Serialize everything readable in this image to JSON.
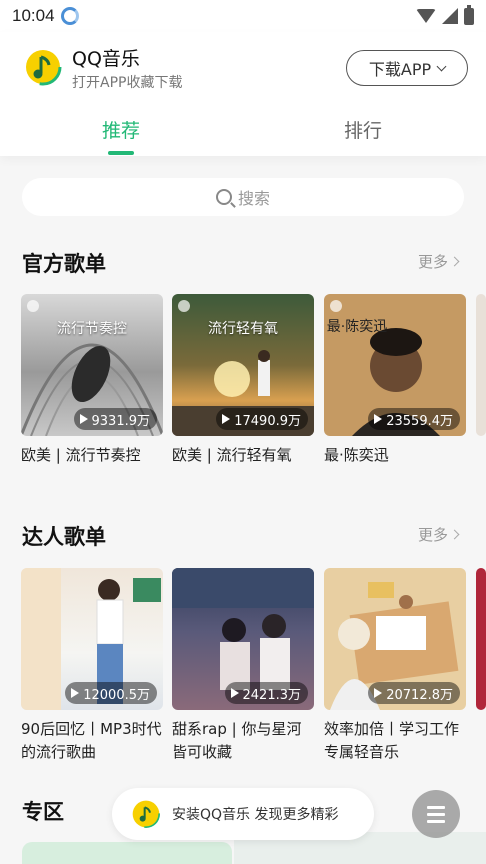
{
  "status_bar": {
    "time": "10:04"
  },
  "header": {
    "app_name": "QQ音乐",
    "subtitle": "打开APP收藏下载",
    "download_label": "下载APP"
  },
  "tabs": [
    {
      "label": "推荐",
      "active": true
    },
    {
      "label": "排行",
      "active": false
    }
  ],
  "search": {
    "placeholder": "搜索"
  },
  "sections": {
    "official": {
      "title": "官方歌单",
      "more": "更多",
      "items": [
        {
          "cover_text": "流行节奏控",
          "plays": "9331.9万",
          "title": "欧美 | 流行节奏控"
        },
        {
          "cover_text": "流行轻有氧",
          "plays": "17490.9万",
          "title": "欧美 | 流行轻有氧"
        },
        {
          "cover_text": "最·陈奕迅",
          "plays": "23559.4万",
          "title": "最·陈奕迅"
        }
      ]
    },
    "expert": {
      "title": "达人歌单",
      "more": "更多",
      "items": [
        {
          "plays": "12000.5万",
          "title": "90后回忆丨MP3时代的流行歌曲"
        },
        {
          "plays": "2421.3万",
          "title": "甜系rap | 你与星河皆可收藏"
        },
        {
          "plays": "20712.8万",
          "title": "效率加倍丨学习工作专属轻音乐"
        }
      ]
    },
    "zone": {
      "title": "专区"
    }
  },
  "promo": {
    "text": "安装QQ音乐 发现更多精彩"
  },
  "colors": {
    "accent": "#22b876",
    "logo_yellow": "#f7d000"
  }
}
